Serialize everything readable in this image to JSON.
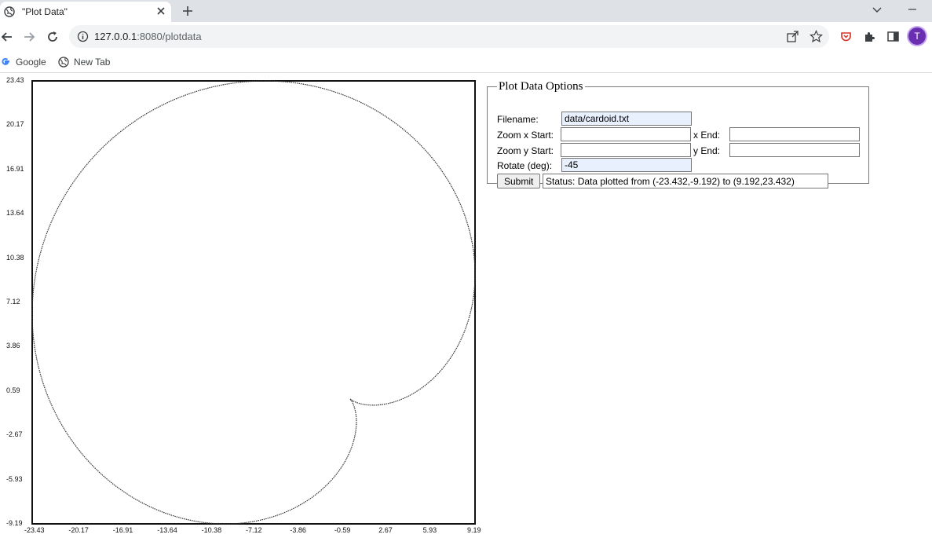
{
  "browser": {
    "tab_title": "\"Plot Data\"",
    "url_host": "127.0.0.1",
    "url_path": ":8080/plotdata",
    "avatar_letter": "T",
    "bookmarks": [
      {
        "label": "Google",
        "icon": "google-icon"
      },
      {
        "label": "New Tab",
        "icon": "globe-icon"
      }
    ]
  },
  "form": {
    "legend": "Plot Data Options",
    "filename_label": "Filename:",
    "filename_value": "data/cardoid.txt",
    "zoomx_label": "Zoom x Start:",
    "zoomx_start": "",
    "xend_label": "x End:",
    "xend_value": "",
    "zoomy_label": "Zoom y Start:",
    "zoomy_start": "",
    "yend_label": "y End:",
    "yend_value": "",
    "rotate_label": "Rotate (deg):",
    "rotate_value": "-45",
    "submit_label": "Submit",
    "status_text": "Status: Data plotted from (-23.432,-9.192) to (9.192,23.432)"
  },
  "chart_data": {
    "type": "line",
    "title": "",
    "xlabel": "",
    "ylabel": "",
    "xlim": [
      -23.43,
      9.19
    ],
    "ylim": [
      -9.19,
      23.43
    ],
    "x_ticks": [
      "-23.43",
      "-20.17",
      "-16.91",
      "-13.64",
      "-10.38",
      "-7.12",
      "-3.86",
      "-0.59",
      "2.67",
      "5.93",
      "9.19"
    ],
    "y_ticks": [
      "23.43",
      "20.17",
      "16.91",
      "13.64",
      "10.38",
      "7.12",
      "3.86",
      "0.59",
      "-2.67",
      "-5.93",
      "-9.19"
    ],
    "curve": {
      "shape": "cardioid",
      "a": 6.5,
      "rotation_deg": -45,
      "cusp": [
        0,
        0
      ]
    },
    "color": "#333333",
    "grid": false
  }
}
